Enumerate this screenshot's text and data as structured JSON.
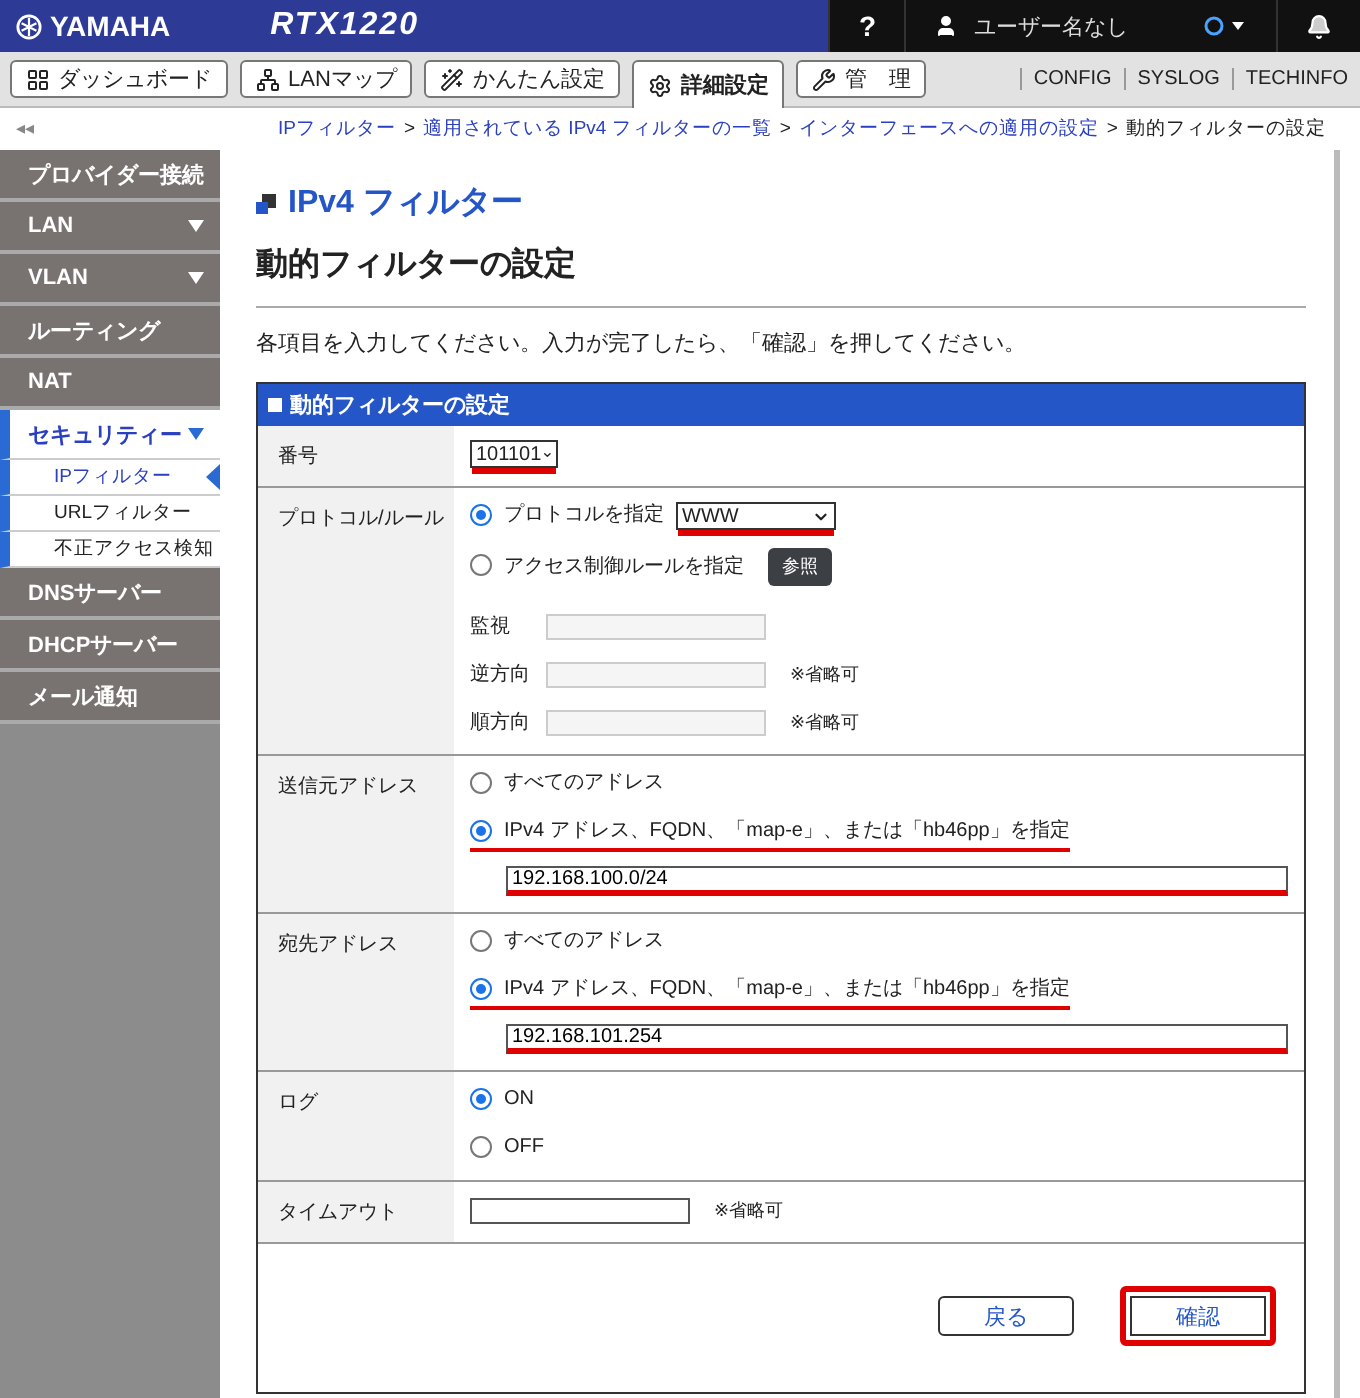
{
  "header": {
    "brand": "YAMAHA",
    "model": "RTX1220",
    "help": "?",
    "user": "ユーザー名なし"
  },
  "nav_tabs": [
    {
      "label": "ダッシュボード",
      "selected": false
    },
    {
      "label": "LANマップ",
      "selected": false
    },
    {
      "label": "かんたん設定",
      "selected": false
    },
    {
      "label": "詳細設定",
      "selected": true
    },
    {
      "label": "管　理",
      "selected": false
    }
  ],
  "nav_links": [
    "CONFIG",
    "SYSLOG",
    "TECHINFO"
  ],
  "collapse": "◂◂",
  "breadcrumb": {
    "separator": ">",
    "items": [
      {
        "label": "IPフィルター",
        "link": true
      },
      {
        "label": "適用されている IPv4 フィルターの一覧",
        "link": true
      },
      {
        "label": "インターフェースへの適用の設定",
        "link": true
      },
      {
        "label": "動的フィルターの設定",
        "link": false
      }
    ]
  },
  "sidebar": [
    {
      "label": "プロバイダー接続",
      "expandable": false,
      "expanded": false
    },
    {
      "label": "LAN",
      "expandable": true,
      "expanded": false
    },
    {
      "label": "VLAN",
      "expandable": true,
      "expanded": false
    },
    {
      "label": "ルーティング",
      "expandable": false,
      "expanded": false
    },
    {
      "label": "NAT",
      "expandable": false,
      "expanded": false
    },
    {
      "label": "セキュリティー",
      "expandable": true,
      "expanded": true,
      "children": [
        {
          "label": "IPフィルター",
          "selected": true
        },
        {
          "label": "URLフィルター",
          "selected": false
        },
        {
          "label": "不正アクセス検知",
          "selected": false
        }
      ]
    },
    {
      "label": "DNSサーバー",
      "expandable": false,
      "expanded": false
    },
    {
      "label": "DHCPサーバー",
      "expandable": false,
      "expanded": false
    },
    {
      "label": "メール通知",
      "expandable": false,
      "expanded": false
    }
  ],
  "page": {
    "section": "IPv4 フィルター",
    "title": "動的フィルターの設定",
    "instruction": "各項目を入力してください。入力が完了したら、「確認」を押してください。"
  },
  "form": {
    "title": "動的フィルターの設定",
    "rows": [
      {
        "label": "番号",
        "lines": [
          {
            "kind": "select",
            "value": "101101",
            "highlighted": true
          }
        ]
      },
      {
        "label": "プロトコル/ルール",
        "lines": [
          {
            "kind": "radio",
            "label": "プロトコルを指定",
            "selected": true,
            "highlighted": false,
            "select": {
              "value": "WWW",
              "highlighted": true
            }
          },
          {
            "kind": "radio",
            "label": "アクセス制御ルールを指定",
            "selected": false,
            "highlighted": false,
            "button": "参照"
          },
          {
            "kind": "field",
            "label": "監視"
          },
          {
            "kind": "field",
            "label": "逆方向",
            "note": "※省略可"
          },
          {
            "kind": "field",
            "label": "順方向",
            "note": "※省略可"
          }
        ]
      },
      {
        "label": "送信元アドレス",
        "lines": [
          {
            "kind": "radio",
            "label": "すべてのアドレス",
            "selected": false,
            "highlighted": false
          },
          {
            "kind": "radio",
            "label": "IPv4 アドレス、FQDN、「map-e」、または「hb46pp」を指定",
            "selected": true,
            "highlighted": true
          },
          {
            "kind": "address",
            "value": "192.168.100.0/24",
            "highlighted": true
          }
        ]
      },
      {
        "label": "宛先アドレス",
        "lines": [
          {
            "kind": "radio",
            "label": "すべてのアドレス",
            "selected": false,
            "highlighted": false
          },
          {
            "kind": "radio",
            "label": "IPv4 アドレス、FQDN、「map-e」、または「hb46pp」を指定",
            "selected": true,
            "highlighted": true
          },
          {
            "kind": "address",
            "value": "192.168.101.254",
            "highlighted": true
          }
        ]
      },
      {
        "label": "ログ",
        "lines": [
          {
            "kind": "radio",
            "label": "ON",
            "selected": true,
            "highlighted": false
          },
          {
            "kind": "radio",
            "label": "OFF",
            "selected": false,
            "highlighted": false
          }
        ]
      },
      {
        "label": "タイムアウト",
        "lines": [
          {
            "kind": "field",
            "note": "※省略可"
          }
        ]
      }
    ]
  },
  "buttons": [
    {
      "label": "戻る",
      "highlighted": false
    },
    {
      "label": "確認",
      "highlighted": true
    }
  ]
}
